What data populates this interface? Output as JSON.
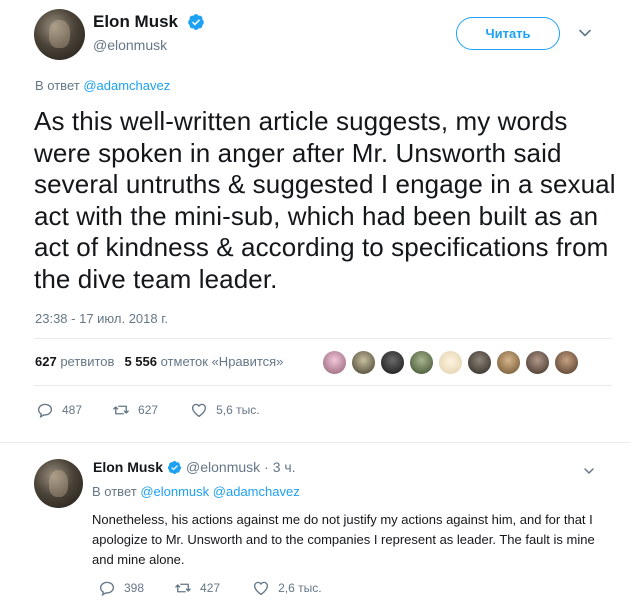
{
  "main_tweet": {
    "author_name": "Elon Musk",
    "author_handle": "@elonmusk",
    "follow_label": "Читать",
    "reply_prefix": "В ответ",
    "reply_to": "@adamchavez",
    "text": "As this well-written article suggests, my words were spoken in anger after Mr. Unsworth said several untruths & suggested I engage in a sexual act with the mini-sub, which had been built as an act of kindness & according to specifications from the dive team leader.",
    "timestamp": "23:38 - 17 июл. 2018 г.",
    "retweets_count": "627",
    "retweets_label": "ретвитов",
    "likes_count": "5 556",
    "likes_label": "отметок «Нравится»",
    "actions": {
      "replies": "487",
      "retweets": "627",
      "likes": "5,6 тыс."
    }
  },
  "reply_tweet": {
    "author_name": "Elon Musk",
    "author_handle": "@elonmusk",
    "time_ago": "· 3 ч.",
    "reply_prefix": "В ответ",
    "reply_to_1": "@elonmusk",
    "reply_to_2": "@adamchavez",
    "text": "Nonetheless, his actions against me do not justify my actions against him, and for that I apologize to Mr. Unsworth and to the companies I represent as leader. The fault is mine and mine alone.",
    "actions": {
      "replies": "398",
      "retweets": "427",
      "likes": "2,6 тыс."
    }
  },
  "icons": [
    "verified-icon",
    "chevron-down-icon",
    "reply-icon",
    "retweet-icon",
    "like-icon"
  ],
  "colors": {
    "accent": "#1da1f2",
    "secondary_text": "#657786",
    "primary_text": "#14171a",
    "divider": "#e6ecf0"
  }
}
